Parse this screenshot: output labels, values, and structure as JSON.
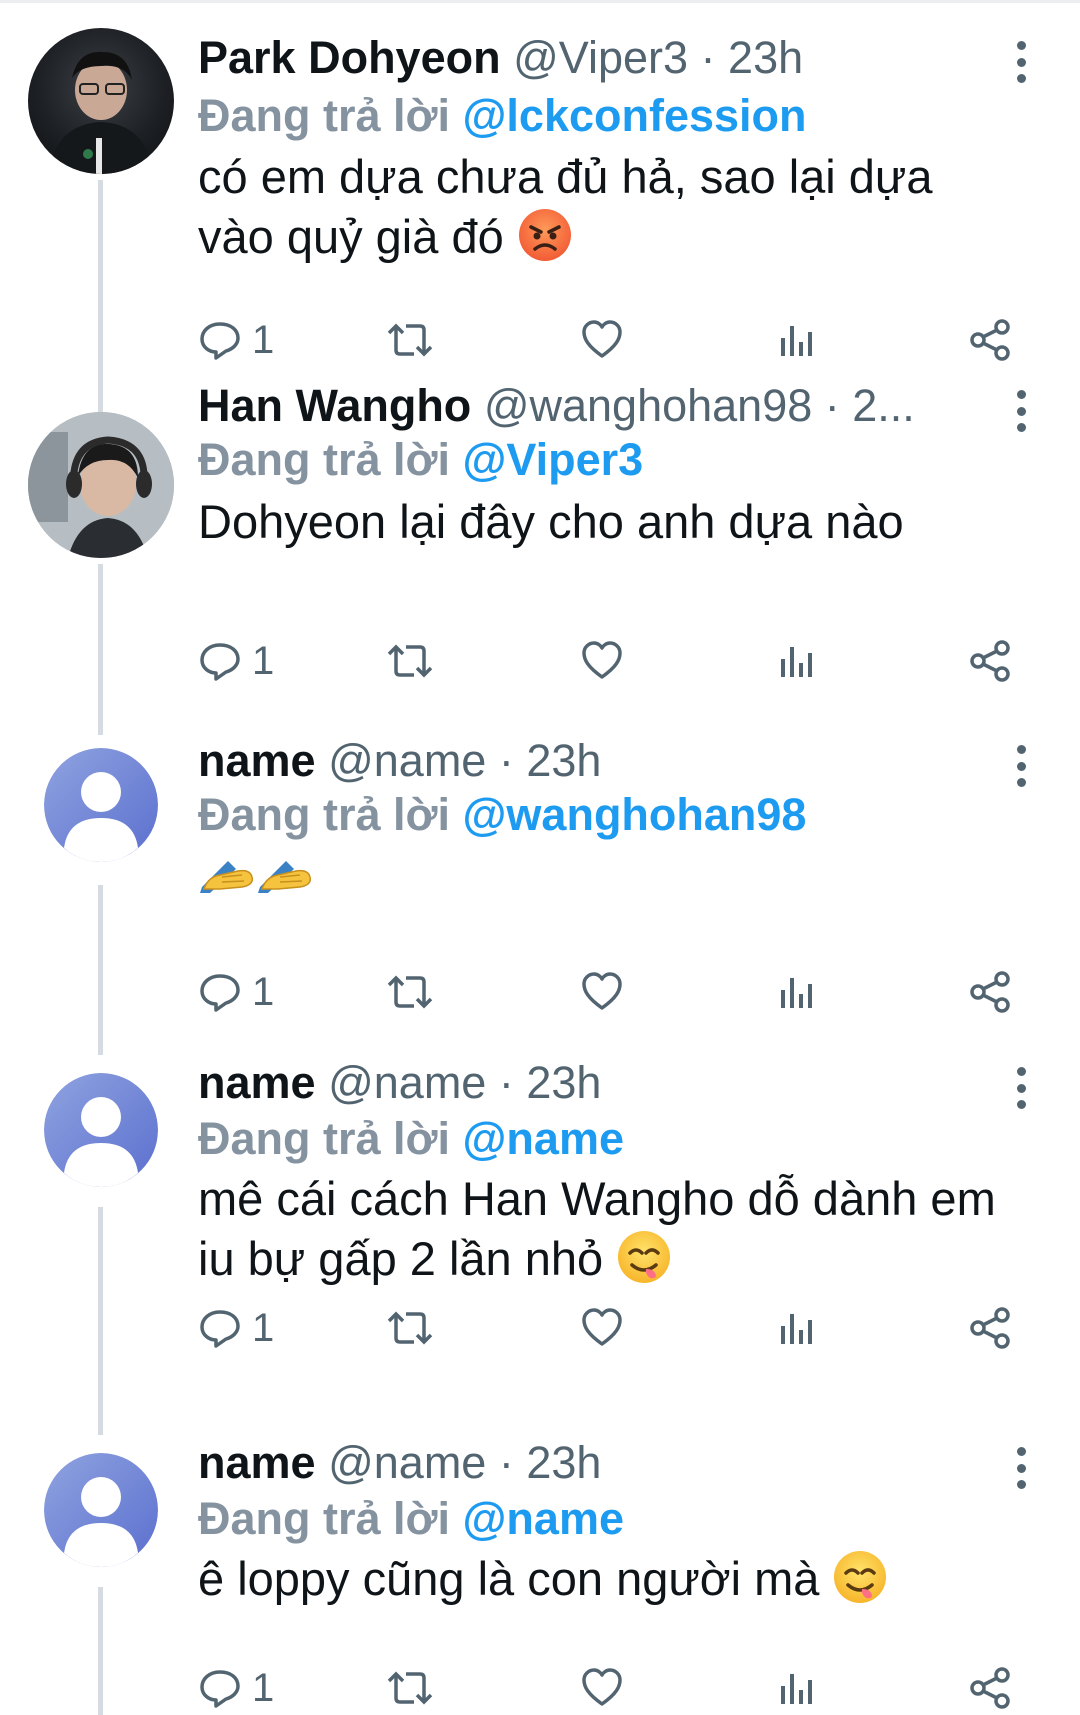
{
  "tweets": [
    {
      "name": "Park Dohyeon",
      "meta": "@Viper3 · 23h",
      "reply_prefix": "Đang trả lời",
      "reply_handle": "@lckconfession",
      "text": "có em dựa chưa đủ hả, sao lại dựa vào quỷ già đó",
      "emoji": "angry-face",
      "reply_count": "1",
      "avatar": "photo"
    },
    {
      "name": "Han Wangho",
      "meta": "@wanghohan98 · 2...",
      "reply_prefix": "Đang trả lời",
      "reply_handle": "@Viper3",
      "text": "Dohyeon lại đây cho anh dựa nào",
      "reply_count": "1",
      "avatar": "photo"
    },
    {
      "name": "name",
      "meta": "@name · 23h",
      "reply_prefix": "Đang trả lời",
      "reply_handle": "@wanghohan98",
      "text": "✍✍",
      "emoji": "writing-hand",
      "reply_count": "1",
      "avatar": "default"
    },
    {
      "name": "name",
      "meta": "@name · 23h",
      "reply_prefix": "Đang trả lời",
      "reply_handle": "@name",
      "text": "mê cái cách Han Wangho dỗ dành em iu bự gấp 2 lần nhỏ",
      "emoji": "yum-face",
      "reply_count": "1",
      "avatar": "default"
    },
    {
      "name": "name",
      "meta": "@name · 23h",
      "reply_prefix": "Đang trả lời",
      "reply_handle": "@name",
      "text": "ê loppy cũng là con người mà",
      "emoji": "yum-face",
      "reply_count": "1",
      "avatar": "default"
    }
  ],
  "icons": [
    "reply-icon",
    "retweet-icon",
    "like-icon",
    "analytics-icon",
    "share-icon",
    "more-icon"
  ],
  "colors": {
    "link": "#1d9bf0",
    "muted": "#536471",
    "reply_prefix": "#8593a0",
    "thread_line": "#d5dbe0",
    "default_avatar": "#6a7fd0"
  }
}
